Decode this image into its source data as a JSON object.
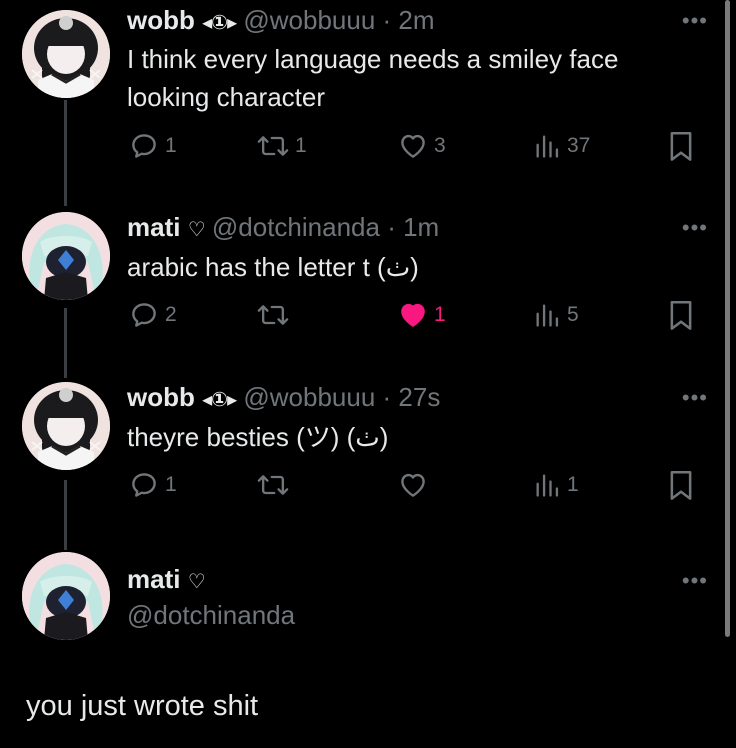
{
  "thread": [
    {
      "author_name": "wobb",
      "badge": "◂①▸",
      "handle": "@wobbuuu",
      "time": "· 2m",
      "text": "I think every language needs a smiley face looking character",
      "replies": "1",
      "reposts": "1",
      "likes": "3",
      "views": "37",
      "liked": false
    },
    {
      "author_name": "mati",
      "badge": "♡",
      "handle": "@dotchinanda",
      "time": "· 1m",
      "text": "arabic has the letter t (ٺ)",
      "replies": "2",
      "reposts": "",
      "likes": "1",
      "views": "5",
      "liked": true
    },
    {
      "author_name": "wobb",
      "badge": "◂①▸",
      "handle": "@wobbuuu",
      "time": "· 27s",
      "text": "theyre besties (ツ) (ٺ)",
      "replies": "1",
      "reposts": "",
      "likes": "",
      "views": "1",
      "liked": false
    }
  ],
  "composer": {
    "author_name": "mati",
    "badge": "♡",
    "handle": "@dotchinanda",
    "reply_text": "you just wrote shit"
  },
  "more_label": "•••",
  "colors": {
    "background": "#000000",
    "text": "#e7e9ea",
    "muted": "#71767b",
    "like": "#f91880"
  },
  "icons": [
    "reply-icon",
    "repost-icon",
    "like-icon",
    "views-icon",
    "bookmark-icon",
    "more-icon"
  ]
}
